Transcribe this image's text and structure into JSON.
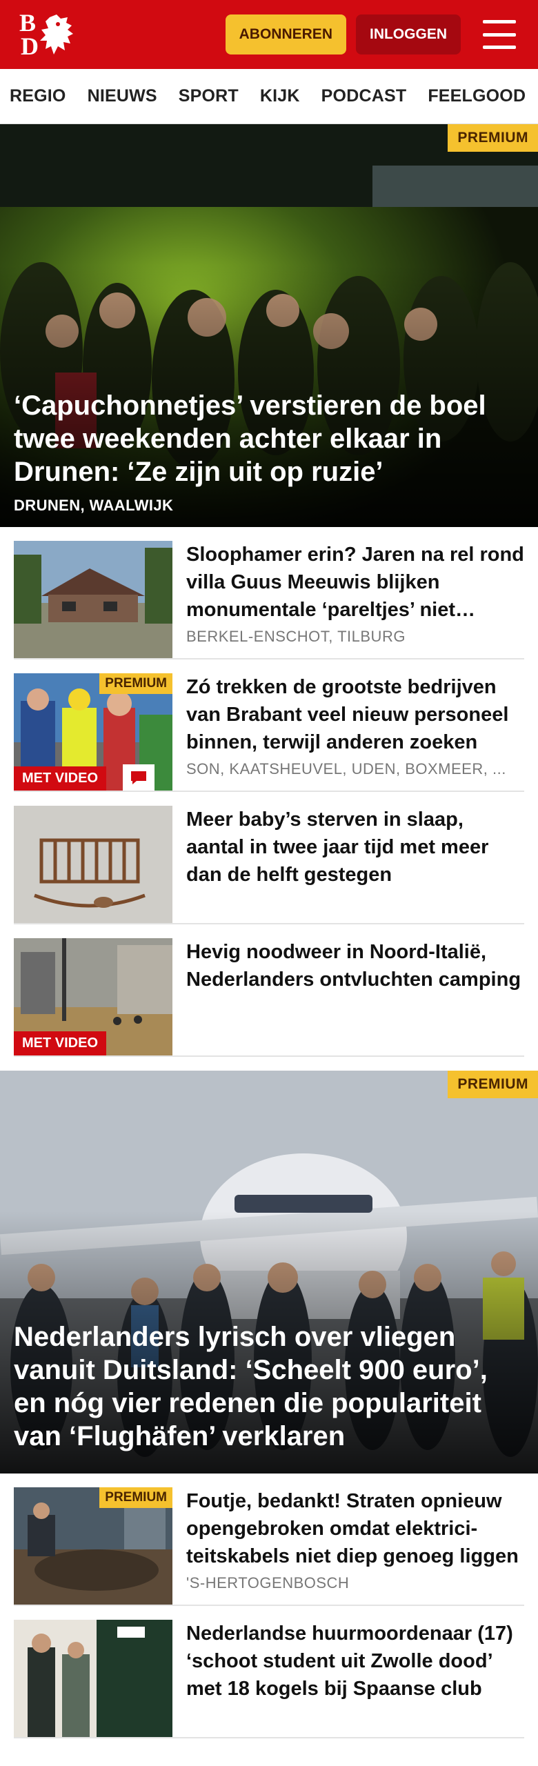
{
  "header": {
    "logo_alt": "BD",
    "subscribe_label": "ABONNEREN",
    "login_label": "INLOGGEN"
  },
  "nav": {
    "items": [
      "REGIO",
      "NIEUWS",
      "SPORT",
      "KIJK",
      "PODCAST",
      "FEELGOOD"
    ]
  },
  "hero1": {
    "badge": "PREMIUM",
    "title": "‘Capuchonnetjes’ verstieren de boel twee weekenden achter elkaar in Drunen: ‘Ze zijn uit op ruzie’",
    "location": "DRUNEN, WAALWIJK"
  },
  "list1": [
    {
      "title": "Sloophamer erin? Jaren na rel rond villa Guus Meeuwis blijken monumentale ‘pareltjes’ niet beschermd",
      "location": "BERKEL-ENSCHOT, TILBURG"
    },
    {
      "badge": "PREMIUM",
      "video": "MET VIDEO",
      "title": "Zó trekken de grootste bedrijven van Brabant veel nieuw personeel binnen, terwijl anderen zoeken",
      "location": "SON, KAATSHEUVEL, UDEN, BOXMEER, ..."
    },
    {
      "title": "Meer baby’s sterven in slaap, aantal in twee jaar tijd met meer dan de helft gestegen",
      "location": ""
    },
    {
      "video": "MET VIDEO",
      "title": "Hevig noodweer in Noord-Italië, Nederlanders ontvluchten camping",
      "location": ""
    }
  ],
  "hero2": {
    "badge": "PREMIUM",
    "title": "Nederlanders lyrisch over vliegen vanuit Duitsland: ‘Scheelt 900 euro’, en nóg vier redenen die populariteit van ‘Flughäfen’ verklaren"
  },
  "list2": [
    {
      "badge": "PREMIUM",
      "title": "Foutje, bedankt! Straten opnieuw opengebroken omdat elektrici-teitskabels niet diep genoeg liggen",
      "location": "'S-HERTOGENBOSCH"
    },
    {
      "title": "Nederlandse huurmoordenaar (17) ‘schoot student uit Zwolle dood’ met 18 kogels bij Spaanse club",
      "location": ""
    }
  ],
  "colors": {
    "brand_red": "#d10a11",
    "premium_yellow": "#f5c12e",
    "login_dark_red": "#a50810"
  }
}
